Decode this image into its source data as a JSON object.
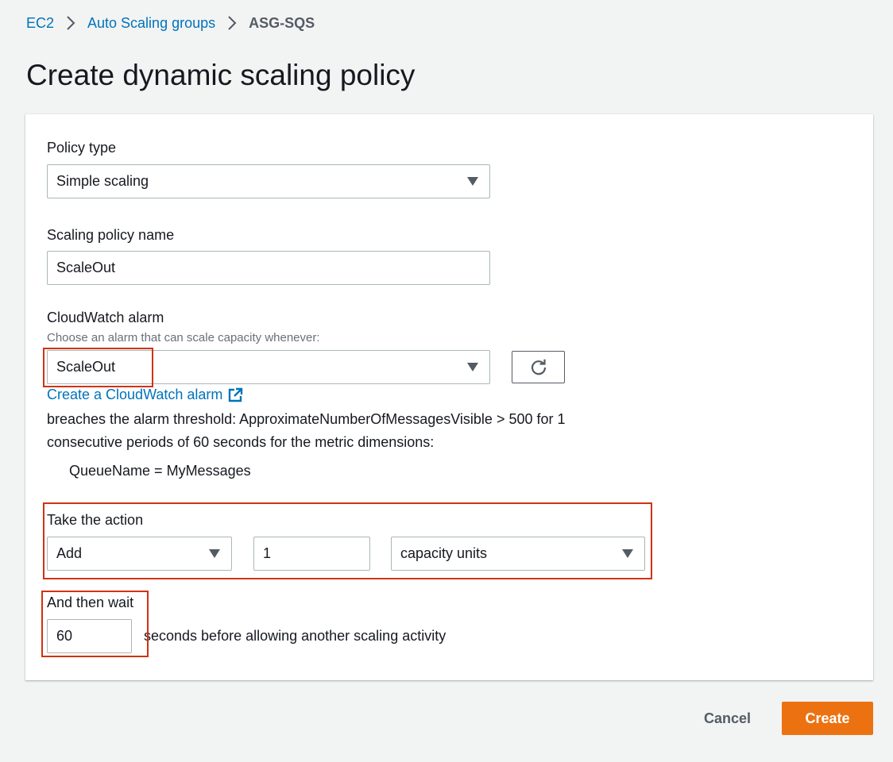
{
  "breadcrumb": {
    "items": [
      "EC2",
      "Auto Scaling groups"
    ],
    "current": "ASG-SQS"
  },
  "page": {
    "title": "Create dynamic scaling policy"
  },
  "form": {
    "policy_type": {
      "label": "Policy type",
      "value": "Simple scaling"
    },
    "policy_name": {
      "label": "Scaling policy name",
      "value": "ScaleOut"
    },
    "alarm": {
      "label": "CloudWatch alarm",
      "description": "Choose an alarm that can scale capacity whenever:",
      "value": "ScaleOut",
      "create_link": "Create a CloudWatch alarm",
      "threshold_line1": "breaches the alarm threshold: ApproximateNumberOfMessagesVisible > 500 for 1",
      "threshold_line2": "consecutive periods of 60 seconds for the metric dimensions:",
      "dimension": "QueueName = MyMessages"
    },
    "action": {
      "label": "Take the action",
      "operation": "Add",
      "amount": "1",
      "unit": "capacity units"
    },
    "wait": {
      "label": "And then wait",
      "value": "60",
      "suffix": "seconds before allowing another scaling activity"
    }
  },
  "footer": {
    "cancel_label": "Cancel",
    "create_label": "Create"
  },
  "colors": {
    "link": "#0073bb",
    "primary": "#ec7211",
    "highlight": "#d13212"
  },
  "icons": [
    "chevron-right-icon",
    "caret-down-icon",
    "refresh-icon",
    "external-link-icon"
  ]
}
